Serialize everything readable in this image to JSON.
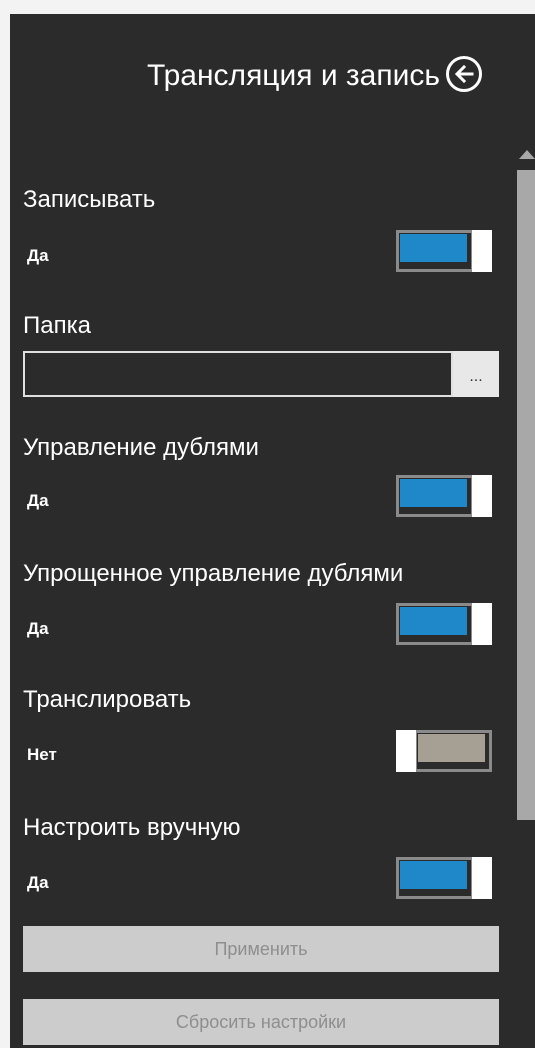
{
  "header": {
    "title": "Трансляция и запись",
    "back_icon": "arrow-left-circle-icon"
  },
  "settings": {
    "record": {
      "label": "Записывать",
      "state": "Да",
      "on": true
    },
    "folder": {
      "label": "Папка",
      "value": "",
      "browse_label": "..."
    },
    "dub_control": {
      "label": "Управление дублями",
      "state": "Да",
      "on": true
    },
    "simple_dub_control": {
      "label": "Упрощенное управление дублями",
      "state": "Да",
      "on": true
    },
    "broadcast": {
      "label": "Транслировать",
      "state": "Нет",
      "on": false
    },
    "manual": {
      "label": "Настроить вручную",
      "state": "Да",
      "on": true
    }
  },
  "buttons": {
    "apply": "Применить",
    "reset": "Сбросить настройки"
  },
  "colors": {
    "panel_bg": "#2b2b2b",
    "toggle_on": "#1e88c8",
    "toggle_off": "#a59f94",
    "button_bg": "#cccccc"
  }
}
